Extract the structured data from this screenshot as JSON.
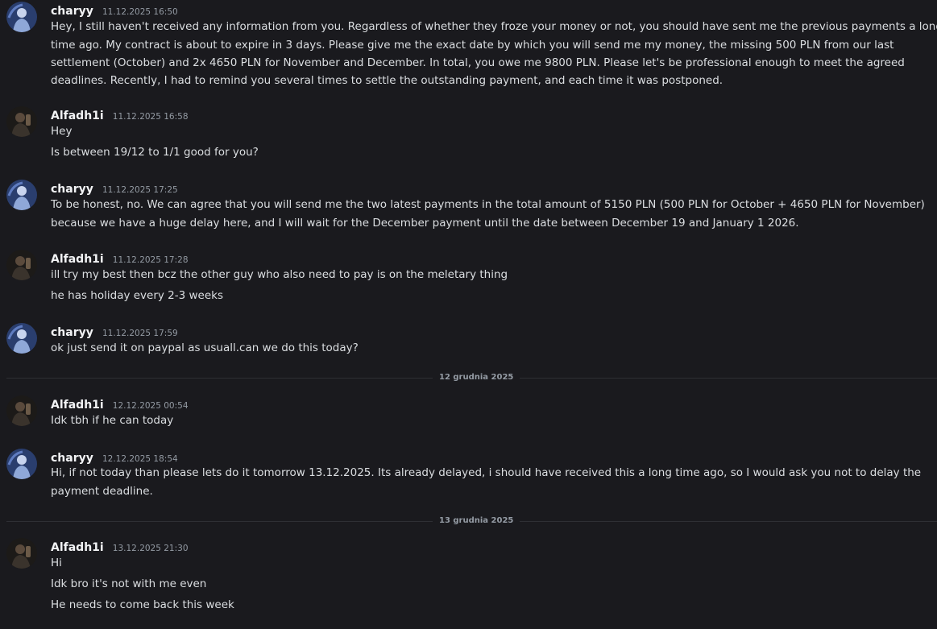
{
  "users": {
    "charyy": "charyy",
    "alfadh": "Alfadh1i"
  },
  "avatars": {
    "charyy": "avatar-icon-blue-figure",
    "alfadh": "avatar-icon-dark-figure"
  },
  "messages": [
    {
      "user": "charyy",
      "time": "11.12.2025 16:50",
      "lines": [
        "Hey, I still haven't received any information from you. Regardless of whether they froze your money or not, you should have sent me the previous payments a long",
        "time ago. My contract is about to expire in 3 days. Please give me the exact date by which you will send me my money, the missing 500 PLN from our last",
        "settlement (October) and 2x 4650 PLN for November and December. In total, you owe me 9800 PLN. Please let's be professional enough to meet the agreed",
        "deadlines. Recently, I had to remind you several times to settle the outstanding payment, and each time it was postponed."
      ]
    },
    {
      "user": "Alfadh1i",
      "time": "11.12.2025 16:58",
      "lines": [
        "Hey",
        "Is between 19/12 to 1/1 good for you?"
      ]
    },
    {
      "user": "charyy",
      "time": "11.12.2025 17:25",
      "lines": [
        "To be honest, no. We can agree that you will send me the two latest payments in the total amount of 5150 PLN (500 PLN for October + 4650 PLN for November)",
        "because we have a huge delay here, and I will wait for the December payment until the date between December 19 and January 1 2026."
      ]
    },
    {
      "user": "Alfadh1i",
      "time": "11.12.2025 17:28",
      "lines": [
        "ill try my best then bcz the other guy who also need to pay is on the meletary thing",
        "he has holiday every 2-3 weeks"
      ]
    },
    {
      "user": "charyy",
      "time": "11.12.2025 17:59",
      "lines": [
        "ok just send it on paypal  as usuall.can we do this today?"
      ]
    },
    {
      "user": "Alfadh1i",
      "time": "12.12.2025 00:54",
      "lines": [
        "Idk tbh if he can today"
      ]
    },
    {
      "user": "charyy",
      "time": "12.12.2025 18:54",
      "lines": [
        "Hi, if not today than please lets do it tomorrow 13.12.2025. Its already delayed, i should have received this a long time ago, so I would ask you not to delay the",
        "payment deadline."
      ]
    },
    {
      "user": "Alfadh1i",
      "time": "13.12.2025 21:30",
      "lines": [
        "Hi",
        "Idk bro  it's not with me even",
        "He needs to come back this week"
      ]
    }
  ],
  "dividers": [
    "12 grudnia 2025",
    "13 grudnia 2025"
  ],
  "colors": {
    "background": "#1a1a1e",
    "username": "#f2f3f5",
    "text": "#dbdee1",
    "timestamp": "#949ba4",
    "divider": "#2e2f34"
  }
}
